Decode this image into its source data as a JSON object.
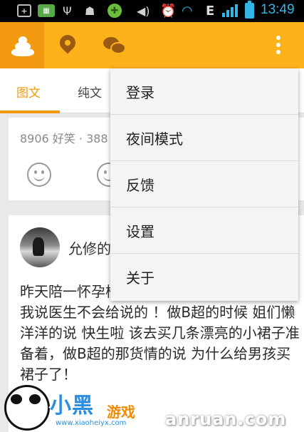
{
  "status_bar": {
    "time": "13:49",
    "network_type": "E",
    "icons": [
      "plus-icon",
      "sim-icon",
      "usb-icon",
      "android-icon",
      "game-icon",
      "volume-icon",
      "alarm-icon",
      "wifi-icon",
      "signal-icon",
      "battery-icon"
    ]
  },
  "action_bar": {
    "accent": "#fdb11a",
    "accent_dark": "#f39a10",
    "icons": [
      "poop-icon",
      "location-pin-icon",
      "chat-icon",
      "overflow-menu-icon"
    ]
  },
  "tabs": [
    {
      "label": "图文",
      "active": true
    },
    {
      "label": "纯文",
      "active": false
    }
  ],
  "card1": {
    "stats": "8906 好笑 · 388"
  },
  "card2": {
    "username": "允修的",
    "text": "昨天陪一怀孕检 不知道男女 好奇想问医生 我说医生不会给说的 ！做B超的时候 姐们懒洋洋的说 快生啦 该去买几条漂亮的小裙子准备着，做B超的那货情的说 为什么给男孩买裙子了！"
  },
  "menu": {
    "items": [
      {
        "label": "登录"
      },
      {
        "label": "夜间模式"
      },
      {
        "label": "反馈"
      },
      {
        "label": "设置"
      },
      {
        "label": "关于"
      }
    ]
  },
  "watermark": {
    "logo": "小黑",
    "logo2": "游戏",
    "url": "www.xiaoheiyx.com",
    "right": "anruan.com"
  }
}
